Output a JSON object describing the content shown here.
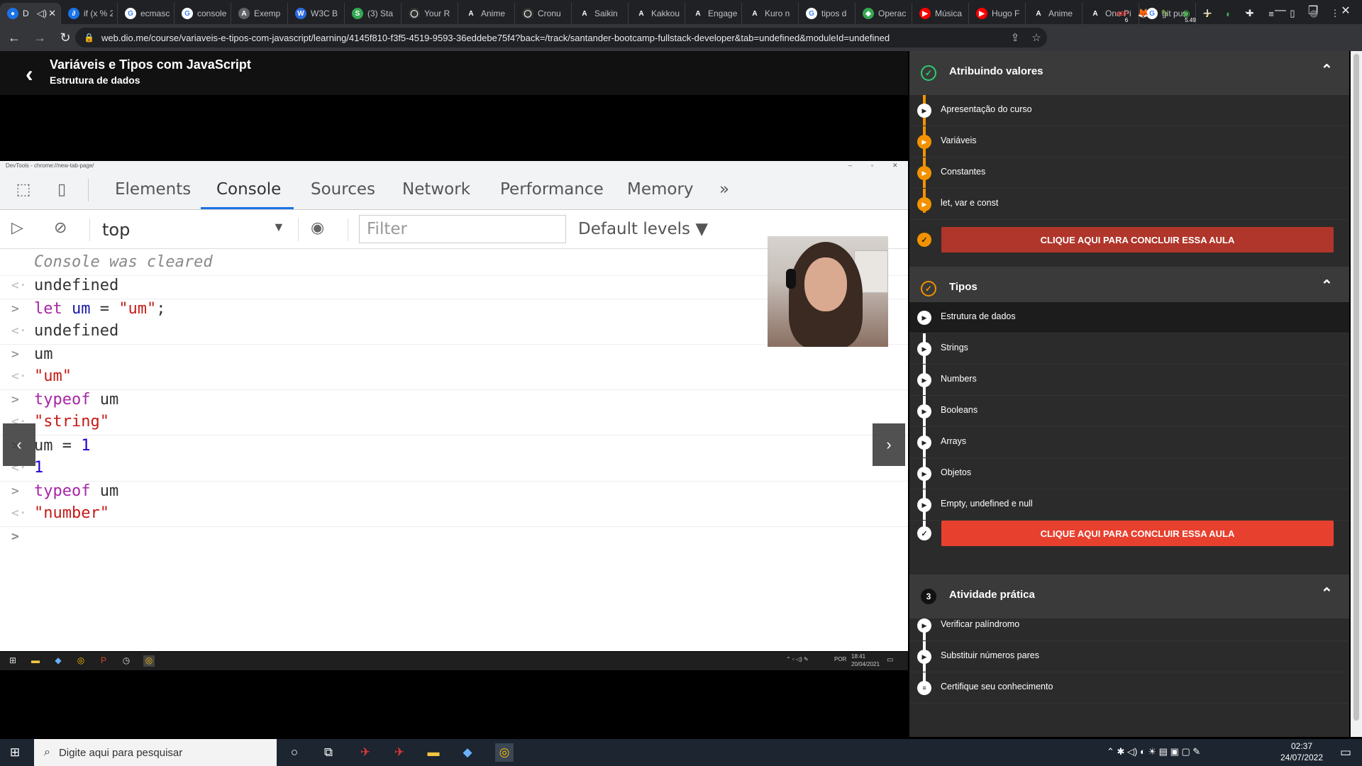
{
  "browser": {
    "tabs": [
      {
        "label": "D",
        "color": "#1a73e8",
        "glyph": "●",
        "active": true
      },
      {
        "label": "if (x % 2",
        "color": "#1a73e8",
        "glyph": "∂"
      },
      {
        "label": "ecmasc",
        "color": "#ffffff",
        "glyph": "G"
      },
      {
        "label": "console",
        "color": "#ffffff",
        "glyph": "G"
      },
      {
        "label": "Exemp",
        "color": "#5f6368",
        "glyph": "A"
      },
      {
        "label": "W3C B",
        "color": "#2d6cdf",
        "glyph": "W"
      },
      {
        "label": "(3) Sta",
        "color": "#34a853",
        "glyph": "S"
      },
      {
        "label": "Your R",
        "color": "#333333",
        "glyph": "◯"
      },
      {
        "label": "Anime",
        "color": "#202124",
        "glyph": "A"
      },
      {
        "label": "Cronu",
        "color": "#333333",
        "glyph": "◯"
      },
      {
        "label": "Saikin",
        "color": "#202124",
        "glyph": "A"
      },
      {
        "label": "Kakkou",
        "color": "#202124",
        "glyph": "A"
      },
      {
        "label": "Engage",
        "color": "#202124",
        "glyph": "A"
      },
      {
        "label": "Kuro n",
        "color": "#202124",
        "glyph": "A"
      },
      {
        "label": "tipos d",
        "color": "#ffffff",
        "glyph": "G"
      },
      {
        "label": "Operac",
        "color": "#34a853",
        "glyph": "◆"
      },
      {
        "label": "Música",
        "color": "#ff0000",
        "glyph": "▶"
      },
      {
        "label": "Hugo F",
        "color": "#ff0000",
        "glyph": "▶"
      },
      {
        "label": "Anime",
        "color": "#202124",
        "glyph": "A"
      },
      {
        "label": "One Pi",
        "color": "#202124",
        "glyph": "A"
      },
      {
        "label": "git pus",
        "color": "#ffffff",
        "glyph": "G"
      }
    ],
    "new_tab": "+",
    "url": "web.dio.me/course/variaveis-e-tipos-com-javascript/learning/4145f810-f3f5-4519-9593-36eddebe75f4?back=/track/santander-bootcamp-fullstack-developer&tab=undefined&moduleId=undefined",
    "nav": {
      "back": "←",
      "forward": "→",
      "reload": "↻"
    },
    "window": {
      "chevron": "⌄",
      "minimize": "—",
      "maximize": "❐",
      "close": "✕"
    },
    "extensions": [
      {
        "glyph": "ABP",
        "color": "#e53935",
        "badge": "6"
      },
      {
        "glyph": "🦊",
        "color": "#f57c00",
        "badge": ""
      },
      {
        "glyph": "✎",
        "color": "#8bc34a",
        "badge": ""
      },
      {
        "glyph": "◉",
        "color": "#4caf50",
        "badge": "5.49"
      },
      {
        "glyph": "♪",
        "color": "#ffeb3b",
        "badge": ""
      },
      {
        "glyph": "◐",
        "color": "#4caf50",
        "badge": ""
      },
      {
        "glyph": "✚",
        "color": "#e8eaed",
        "badge": ""
      },
      {
        "glyph": "≡",
        "color": "#e8eaed",
        "badge": ""
      },
      {
        "glyph": "▯",
        "color": "#e8eaed",
        "badge": ""
      },
      {
        "glyph": "◍",
        "color": "#9e9e9e",
        "badge": ""
      },
      {
        "glyph": "⋮",
        "color": "#e8eaed",
        "badge": ""
      }
    ]
  },
  "video": {
    "back_glyph": "‹",
    "title": "Variáveis e Tipos com JavaScript",
    "subtitle": "Estrutura de dados",
    "devtools": {
      "window_title": "DevTools - chrome://new-tab-page/",
      "tabs": [
        "Elements",
        "Console",
        "Sources",
        "Network",
        "Performance",
        "Memory"
      ],
      "more": "»",
      "context": "top",
      "filter_placeholder": "Filter",
      "levels": "Default levels ▼",
      "console_lines": [
        {
          "type": "info",
          "marker": "",
          "parts": [
            {
              "t": "Console was cleared",
              "c": "muted"
            }
          ]
        },
        {
          "type": "out",
          "marker": "<·",
          "parts": [
            {
              "t": "undefined",
              "c": "txt"
            }
          ]
        },
        {
          "type": "in",
          "marker": ">",
          "parts": [
            {
              "t": "let ",
              "c": "kw"
            },
            {
              "t": "um",
              "c": "var"
            },
            {
              "t": " = ",
              "c": "txt"
            },
            {
              "t": "\"um\"",
              "c": "str"
            },
            {
              "t": ";",
              "c": "txt"
            }
          ]
        },
        {
          "type": "out",
          "marker": "<·",
          "parts": [
            {
              "t": "undefined",
              "c": "txt"
            }
          ]
        },
        {
          "type": "in",
          "marker": ">",
          "parts": [
            {
              "t": "um",
              "c": "txt"
            }
          ]
        },
        {
          "type": "out",
          "marker": "<·",
          "parts": [
            {
              "t": "\"um\"",
              "c": "str"
            }
          ]
        },
        {
          "type": "in",
          "marker": ">",
          "parts": [
            {
              "t": "typeof ",
              "c": "kw"
            },
            {
              "t": "um",
              "c": "txt"
            }
          ]
        },
        {
          "type": "out",
          "marker": "<·",
          "parts": [
            {
              "t": "\"string\"",
              "c": "str"
            }
          ]
        },
        {
          "type": "in",
          "marker": ">",
          "parts": [
            {
              "t": "um",
              "c": "txt"
            },
            {
              "t": " = ",
              "c": "txt"
            },
            {
              "t": "1",
              "c": "num"
            }
          ]
        },
        {
          "type": "out",
          "marker": "<·",
          "parts": [
            {
              "t": "1",
              "c": "num"
            }
          ]
        },
        {
          "type": "in",
          "marker": ">",
          "parts": [
            {
              "t": "typeof ",
              "c": "kw"
            },
            {
              "t": "um",
              "c": "txt"
            }
          ]
        },
        {
          "type": "out",
          "marker": "<·",
          "parts": [
            {
              "t": "\"number\"",
              "c": "str"
            }
          ]
        },
        {
          "type": "prompt",
          "marker": ">",
          "parts": []
        }
      ]
    },
    "prev_glyph": "‹",
    "next_glyph": "›",
    "inner_taskbar": {
      "clock_time": "18:41",
      "clock_date": "20/04/2021",
      "lang": "POR"
    }
  },
  "sidebar": {
    "sections": [
      {
        "number": "✓",
        "icon_color": "#2ecc71",
        "title": "Atribuindo valores",
        "collapse": "⌃",
        "lessons": [
          "Apresentação do curso",
          "Variáveis",
          "Constantes",
          "let, var e const"
        ],
        "complete_label": "CLIQUE AQUI PARA CONCLUIR ESSA AULA"
      },
      {
        "number": "✓",
        "icon_color": "#f39200",
        "title": "Tipos",
        "collapse": "⌃",
        "lessons": [
          "Estrutura de dados",
          "Strings",
          "Numbers",
          "Booleans",
          "Arrays",
          "Objetos",
          "Empty, undefined e null"
        ],
        "current_lesson": "Estrutura de dados",
        "complete_label": "CLIQUE AQUI PARA CONCLUIR ESSA AULA"
      },
      {
        "number": "3",
        "icon_color": "#111111",
        "title": "Atividade prática",
        "collapse": "⌃",
        "lessons": [
          "Verificar palíndromo",
          "Substituir números pares",
          "Certifique seu conhecimento"
        ]
      }
    ]
  },
  "taskbar": {
    "search_placeholder": "Digite aqui para pesquisar",
    "time": "02:37",
    "date": "24/07/2022",
    "notification_count": "1"
  }
}
